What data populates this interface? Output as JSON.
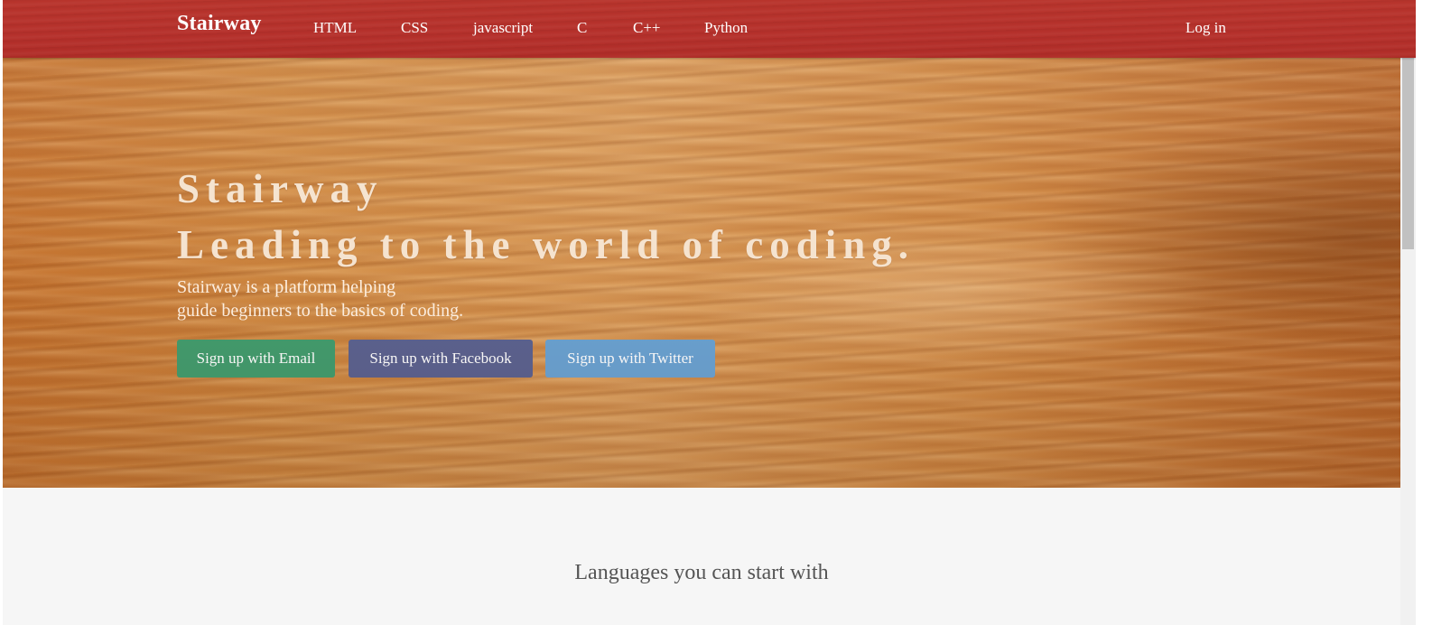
{
  "navbar": {
    "brand": "Stairway",
    "links": [
      "HTML",
      "CSS",
      "javascript",
      "C",
      "C++",
      "Python"
    ],
    "login": "Log in"
  },
  "hero": {
    "title_line1": "Stairway",
    "title_line2": "Leading to the world of coding.",
    "desc_line1": "Stairway is a platform helping",
    "desc_line2": "guide beginners to the basics of coding.",
    "buttons": {
      "email": "Sign up with Email",
      "facebook": "Sign up with Facebook",
      "twitter": "Sign up with Twitter"
    }
  },
  "languages": {
    "title": "Languages you can start with"
  },
  "colors": {
    "navbar_red": "#b5302b",
    "email_green": "#429c6e",
    "facebook_blue": "#5b6290",
    "twitter_blue": "#6aa2d2"
  }
}
